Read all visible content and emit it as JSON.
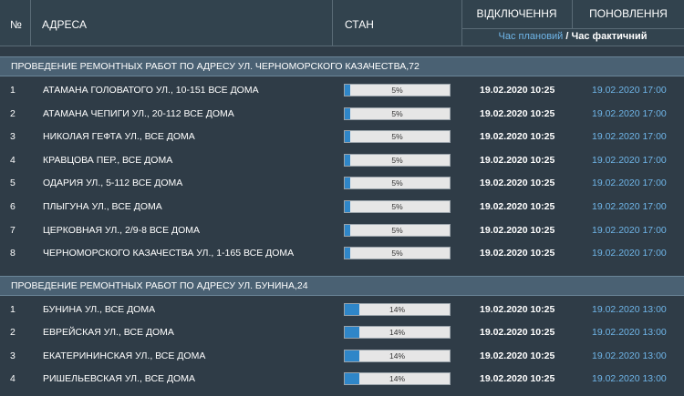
{
  "header": {
    "no": "№",
    "address": "АДРЕСА",
    "state": "СТАН",
    "off": "ВІДКЛЮЧЕННЯ",
    "on": "ПОНОВЛЕННЯ",
    "time_planned": "Час плановий",
    "time_sep": " / ",
    "time_fact": "Час фактичний"
  },
  "groups": [
    {
      "title": "ПРОВЕДЕНИЕ РЕМОНТНЫХ РАБОТ ПО АДРЕСУ УЛ. ЧЕРНОМОРСКОГО КАЗАЧЕСТВА,72",
      "rows": [
        {
          "no": "1",
          "address": "АТАМАНА ГОЛОВАТОГО УЛ., 10-151 ВСЕ ДОМА",
          "progress": "5%",
          "off": "19.02.2020 10:25",
          "on": "19.02.2020 17:00"
        },
        {
          "no": "2",
          "address": "АТАМАНА ЧЕПИГИ УЛ., 20-112 ВСЕ ДОМА",
          "progress": "5%",
          "off": "19.02.2020 10:25",
          "on": "19.02.2020 17:00"
        },
        {
          "no": "3",
          "address": "НИКОЛАЯ ГЕФТА УЛ., ВСЕ ДОМА",
          "progress": "5%",
          "off": "19.02.2020 10:25",
          "on": "19.02.2020 17:00"
        },
        {
          "no": "4",
          "address": "КРАВЦОВА ПЕР., ВСЕ ДОМА",
          "progress": "5%",
          "off": "19.02.2020 10:25",
          "on": "19.02.2020 17:00"
        },
        {
          "no": "5",
          "address": "ОДАРИЯ УЛ., 5-112 ВСЕ ДОМА",
          "progress": "5%",
          "off": "19.02.2020 10:25",
          "on": "19.02.2020 17:00"
        },
        {
          "no": "6",
          "address": "ПЛЫГУНА УЛ., ВСЕ ДОМА",
          "progress": "5%",
          "off": "19.02.2020 10:25",
          "on": "19.02.2020 17:00"
        },
        {
          "no": "7",
          "address": "ЦЕРКОВНАЯ УЛ., 2/9-8 ВСЕ ДОМА",
          "progress": "5%",
          "off": "19.02.2020 10:25",
          "on": "19.02.2020 17:00"
        },
        {
          "no": "8",
          "address": "ЧЕРНОМОРСКОГО КАЗАЧЕСТВА УЛ., 1-165 ВСЕ ДОМА",
          "progress": "5%",
          "off": "19.02.2020 10:25",
          "on": "19.02.2020 17:00"
        }
      ]
    },
    {
      "title": "ПРОВЕДЕНИЕ РЕМОНТНЫХ РАБОТ ПО АДРЕСУ УЛ. БУНИНА,24",
      "rows": [
        {
          "no": "1",
          "address": "БУНИНА УЛ., ВСЕ ДОМА",
          "progress": "14%",
          "off": "19.02.2020 10:25",
          "on": "19.02.2020 13:00"
        },
        {
          "no": "2",
          "address": "ЕВРЕЙСКАЯ УЛ., ВСЕ ДОМА",
          "progress": "14%",
          "off": "19.02.2020 10:25",
          "on": "19.02.2020 13:00"
        },
        {
          "no": "3",
          "address": "ЕКАТЕРИНИНСКАЯ УЛ., ВСЕ ДОМА",
          "progress": "14%",
          "off": "19.02.2020 10:25",
          "on": "19.02.2020 13:00"
        },
        {
          "no": "4",
          "address": "РИШЕЛЬЕВСКАЯ УЛ., ВСЕ ДОМА",
          "progress": "14%",
          "off": "19.02.2020 10:25",
          "on": "19.02.2020 13:00"
        }
      ]
    }
  ],
  "colors": {
    "accent": "#2f86c8",
    "time_link": "#6fb5e8",
    "group_band": "#4a6173",
    "background": "#2f3c47"
  }
}
